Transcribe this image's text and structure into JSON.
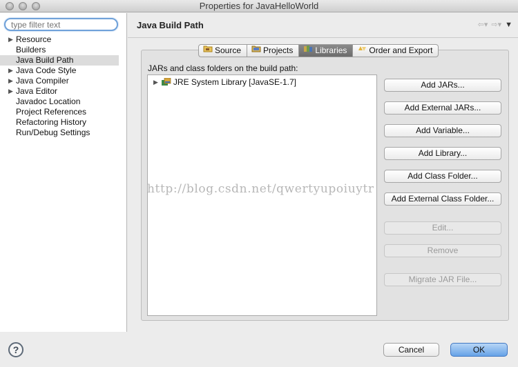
{
  "window": {
    "title": "Properties for JavaHelloWorld"
  },
  "filter": {
    "placeholder": "type filter text",
    "value": ""
  },
  "tree": [
    {
      "label": "Resource",
      "expandable": true
    },
    {
      "label": "Builders",
      "expandable": false
    },
    {
      "label": "Java Build Path",
      "expandable": false,
      "selected": true
    },
    {
      "label": "Java Code Style",
      "expandable": true
    },
    {
      "label": "Java Compiler",
      "expandable": true
    },
    {
      "label": "Java Editor",
      "expandable": true
    },
    {
      "label": "Javadoc Location",
      "expandable": false
    },
    {
      "label": "Project References",
      "expandable": false
    },
    {
      "label": "Refactoring History",
      "expandable": false
    },
    {
      "label": "Run/Debug Settings",
      "expandable": false
    }
  ],
  "header": {
    "title": "Java Build Path"
  },
  "tabs": [
    {
      "label": "Source",
      "icon": "source-folder-icon"
    },
    {
      "label": "Projects",
      "icon": "projects-icon"
    },
    {
      "label": "Libraries",
      "icon": "libraries-icon",
      "active": true
    },
    {
      "label": "Order and Export",
      "icon": "order-export-icon"
    }
  ],
  "build_path": {
    "label": "JARs and class folders on the build path:",
    "entries": [
      {
        "label": "JRE System Library [JavaSE-1.7]"
      }
    ]
  },
  "buttons": {
    "add_jars": "Add JARs...",
    "add_external_jars": "Add External JARs...",
    "add_variable": "Add Variable...",
    "add_library": "Add Library...",
    "add_class_folder": "Add Class Folder...",
    "add_external_class_folder": "Add External Class Folder...",
    "edit": "Edit...",
    "remove": "Remove",
    "migrate_jar": "Migrate JAR File..."
  },
  "watermark": "http://blog.csdn.net/qwertyupoiuytr",
  "footer": {
    "help": "?",
    "cancel": "Cancel",
    "ok": "OK"
  },
  "colors": {
    "accent": "#66a2e7",
    "focus_ring": "#6fa1d9",
    "active_tab": "#6c6c6c"
  }
}
